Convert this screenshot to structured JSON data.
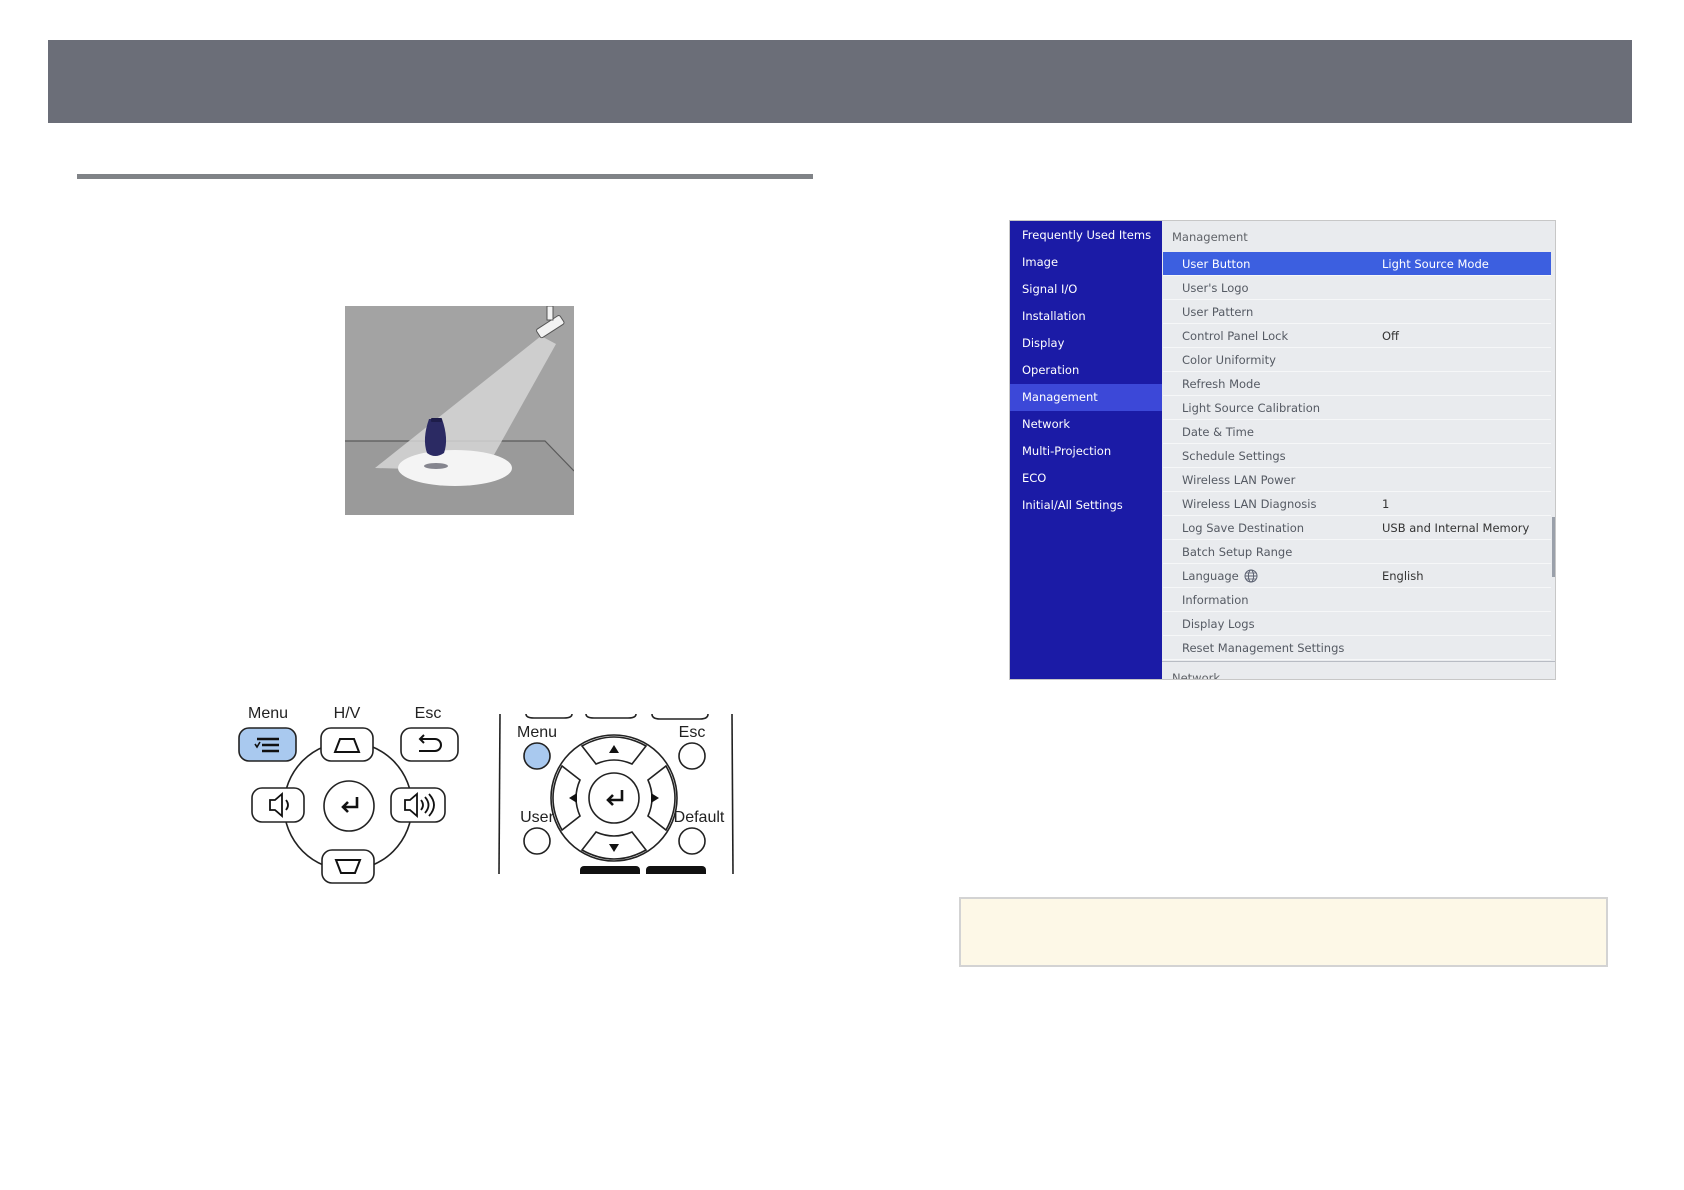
{
  "panel_labels": {
    "menu": "Menu",
    "hv": "H/V",
    "esc": "Esc"
  },
  "remote_labels": {
    "menu": "Menu",
    "esc": "Esc",
    "user": "User",
    "default": "Default"
  },
  "colors": {
    "header": "#6b6e78",
    "menu_sidebar": "#1b1ba6",
    "menu_active": "#3c48d8",
    "menu_selected_row": "#3c5fe0",
    "highlighted_button": "#a9c9ef",
    "note_background": "#fdf8e7"
  },
  "osd_menu": {
    "sidebar": [
      {
        "label": "Frequently Used Items",
        "active": false
      },
      {
        "label": "Image",
        "active": false
      },
      {
        "label": "Signal I/O",
        "active": false
      },
      {
        "label": "Installation",
        "active": false
      },
      {
        "label": "Display",
        "active": false
      },
      {
        "label": "Operation",
        "active": false
      },
      {
        "label": "Management",
        "active": true
      },
      {
        "label": "Network",
        "active": false
      },
      {
        "label": "Multi-Projection",
        "active": false
      },
      {
        "label": "ECO",
        "active": false
      },
      {
        "label": "Initial/All Settings",
        "active": false
      }
    ],
    "section_title": "Management",
    "rows": [
      {
        "label": "User Button",
        "value": "Light Source Mode",
        "selected": true
      },
      {
        "label": "User's Logo",
        "value": ""
      },
      {
        "label": "User Pattern",
        "value": ""
      },
      {
        "label": "Control Panel Lock",
        "value": "Off"
      },
      {
        "label": "Color Uniformity",
        "value": ""
      },
      {
        "label": "Refresh Mode",
        "value": ""
      },
      {
        "label": "Light Source Calibration",
        "value": ""
      },
      {
        "label": "Date & Time",
        "value": ""
      },
      {
        "label": "Schedule Settings",
        "value": ""
      },
      {
        "label": "Wireless LAN Power",
        "value": ""
      },
      {
        "label": "Wireless LAN Diagnosis",
        "value": "1"
      },
      {
        "label": "Log Save Destination",
        "value": "USB and Internal Memory"
      },
      {
        "label": "Batch Setup Range",
        "value": ""
      },
      {
        "label": "Language",
        "value": "English",
        "icon": "globe-icon"
      },
      {
        "label": "Information",
        "value": ""
      },
      {
        "label": "Display Logs",
        "value": ""
      },
      {
        "label": "Reset Management Settings",
        "value": ""
      }
    ],
    "next_section": "Network"
  }
}
